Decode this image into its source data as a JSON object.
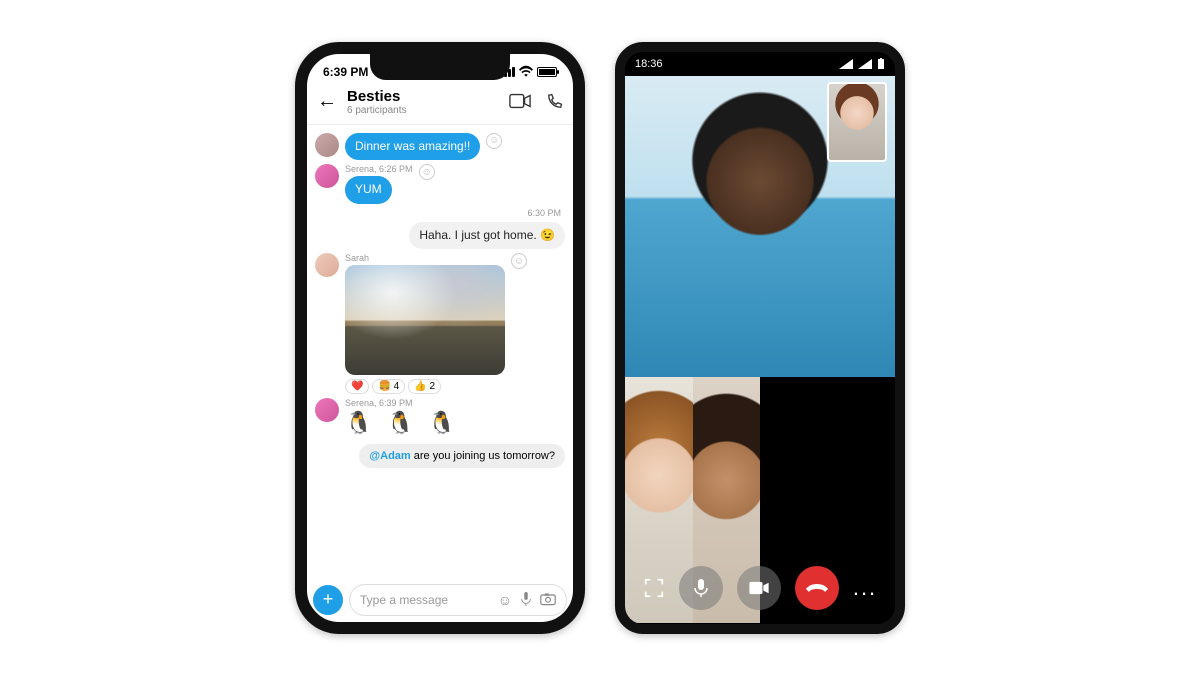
{
  "iphone": {
    "status_time": "6:39 PM",
    "chat": {
      "title": "Besties",
      "subtitle": "6 participants",
      "messages": {
        "m1": {
          "text": "Dinner was amazing!!"
        },
        "m2": {
          "meta": "Serena, 6:26 PM",
          "text": "YUM"
        },
        "m3": {
          "time": "6:30 PM",
          "text": "Haha. I just got home. 😉"
        },
        "m4": {
          "meta": "Sarah"
        },
        "reactions": {
          "r1": "❤️",
          "r2": "🍔 4",
          "r3": "👍 2"
        },
        "m5": {
          "meta": "Serena, 6:39 PM",
          "stickers": "🐧 🐧 🐧"
        },
        "mention": {
          "handle": "@Adam",
          "rest": " are you joining us tomorrow?"
        }
      },
      "composer_placeholder": "Type a message"
    }
  },
  "android": {
    "status_time": "18:36",
    "call_controls": {
      "focus": "focus-icon",
      "mic": "mic-icon",
      "video": "video-icon",
      "end": "end-call-icon",
      "more": "..."
    }
  }
}
